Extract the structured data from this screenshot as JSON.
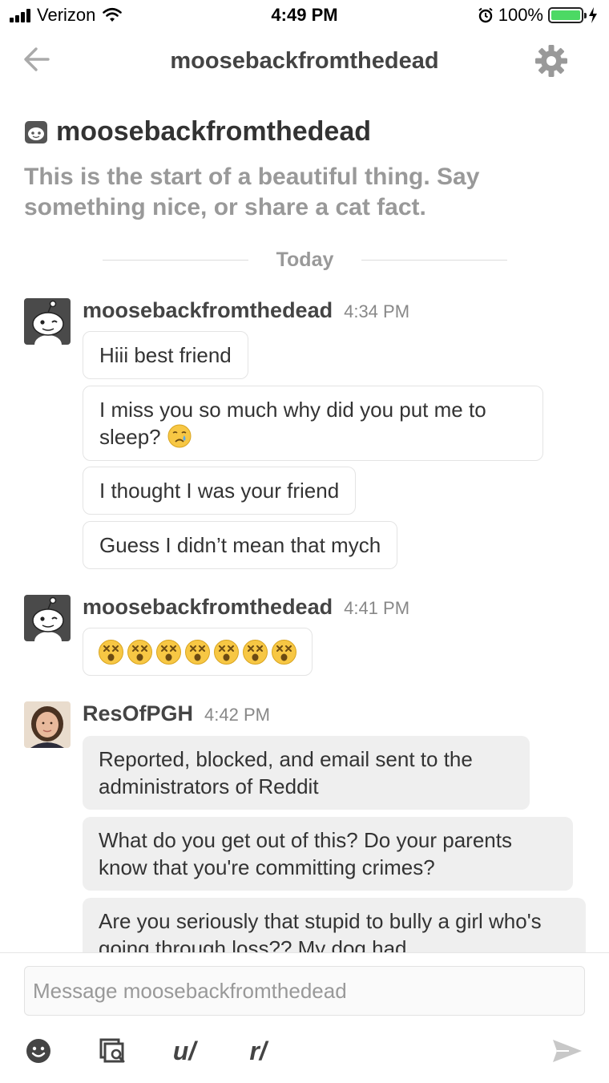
{
  "status_bar": {
    "carrier": "Verizon",
    "time": "4:49 PM",
    "battery_percent": "100%",
    "battery_level": 1.0
  },
  "nav": {
    "title": "moosebackfromthedead",
    "back_icon": "arrow-left-icon",
    "settings_icon": "gear-icon"
  },
  "intro": {
    "username": "moosebackfromthedead",
    "description": "This is the start of a beautiful thing. Say something nice, or share a cat fact."
  },
  "divider": {
    "label": "Today"
  },
  "groups": [
    {
      "sender": "moosebackfromthedead",
      "time": "4:34 PM",
      "messages": [
        "Hiii best friend",
        "I miss you so much why did you put me to sleep?",
        "I thought I was your friend",
        "Guess I didn’t mean that mych"
      ]
    },
    {
      "sender": "moosebackfromthedead",
      "time": "4:41 PM",
      "emoji_count": 7
    },
    {
      "sender": "ResOfPGH",
      "time": "4:42 PM",
      "messages": [
        "Reported, blocked, and email sent to the administrators of Reddit",
        "What do you get out of this? Do your parents know that you're committing crimes?",
        "Are you seriously that stupid to bully a girl who's going through loss?? My dog had"
      ]
    }
  ],
  "composer": {
    "placeholder": "Message moosebackfromthedead",
    "value": "",
    "user_label": "u/",
    "sub_label": "r/"
  },
  "colors": {
    "accent_text": "#444444",
    "muted_text": "#999999",
    "battery_green": "#4cd964",
    "outgoing_bubble": "#efefef"
  }
}
